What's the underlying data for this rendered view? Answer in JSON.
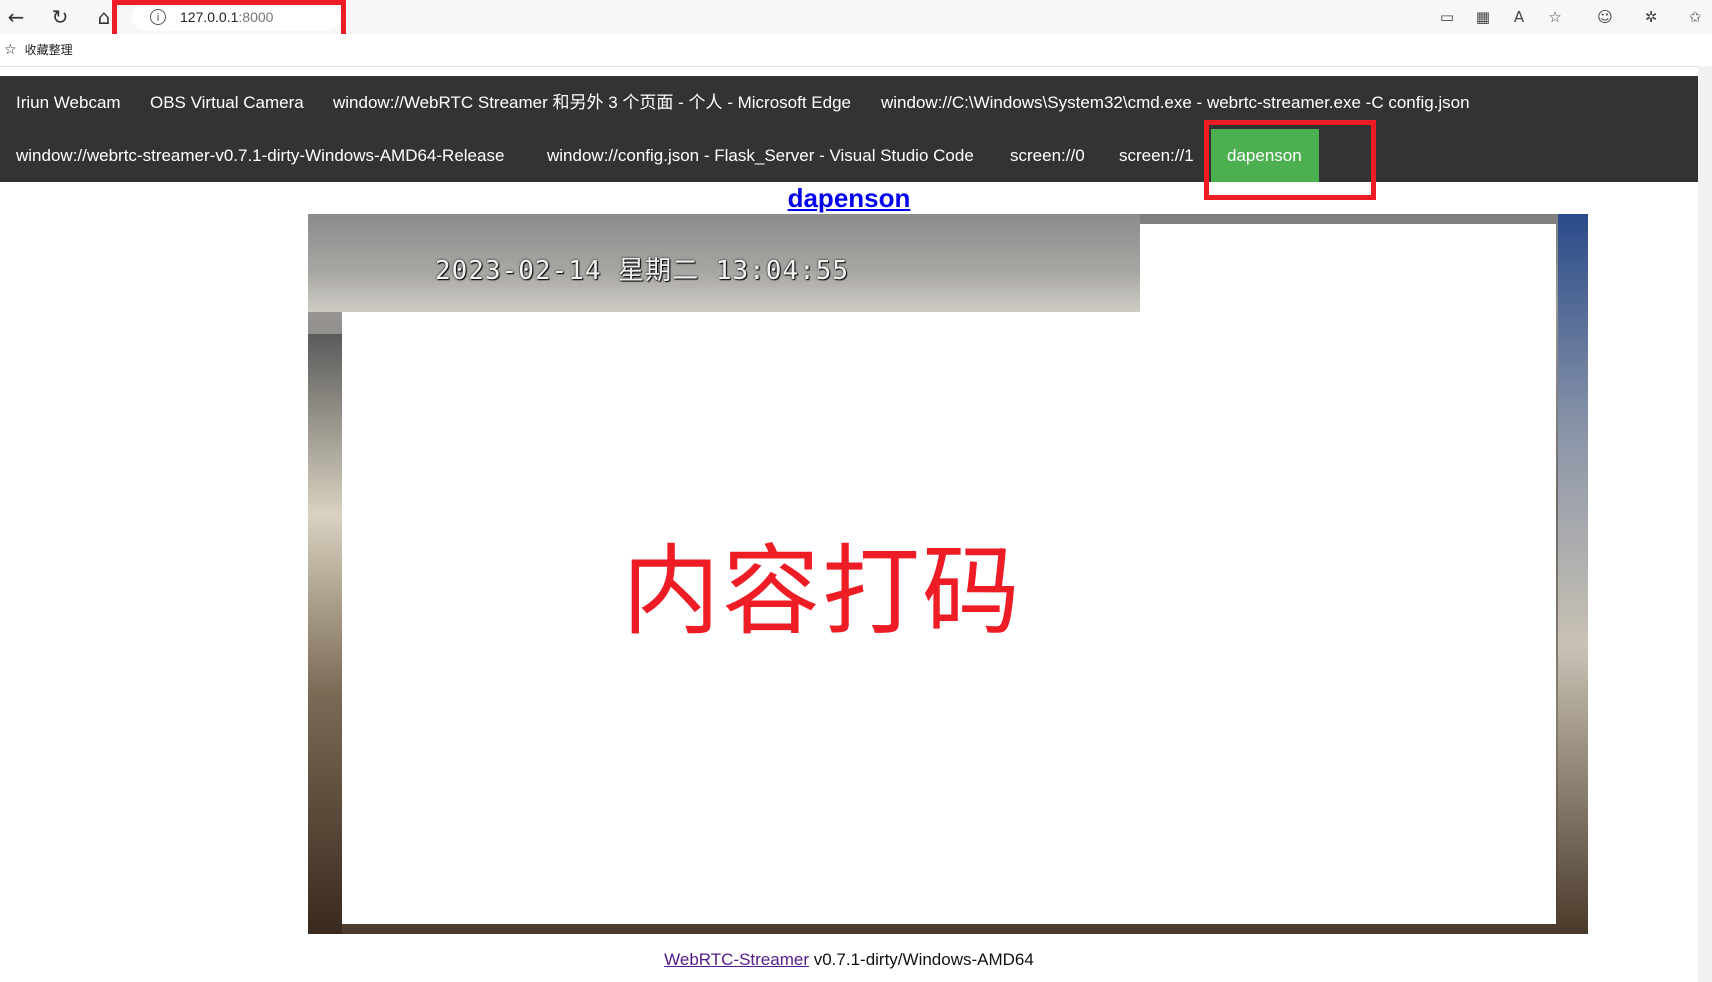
{
  "browser": {
    "address": {
      "host": "127.0.0.1",
      "port": ":8000"
    },
    "favorites_label": "收藏整理"
  },
  "nav": {
    "items": [
      "Iriun Webcam",
      "OBS Virtual Camera",
      "window://WebRTC Streamer 和另外 3 个页面 - 个人 - Microsoft Edge",
      "window://C:\\Windows\\System32\\cmd.exe - webrtc-streamer.exe -C config.json",
      "window://webrtc-streamer-v0.7.1-dirty-Windows-AMD64-Release",
      "window://config.json - Flask_Server - Visual Studio Code",
      "screen://0",
      "screen://1",
      "dapenson"
    ],
    "active": "dapenson",
    "active_color": "#4CAF50",
    "bar_color": "#333333"
  },
  "main": {
    "title": "dapenson",
    "video_overlay_timestamp": "2023-02-14 星期二 13:04:55",
    "redaction_label": "内容打码"
  },
  "footer": {
    "link_text": "WebRTC-Streamer",
    "version_text": " v0.7.1-dirty/Windows-AMD64"
  },
  "annotation_color": "#ee1c25"
}
